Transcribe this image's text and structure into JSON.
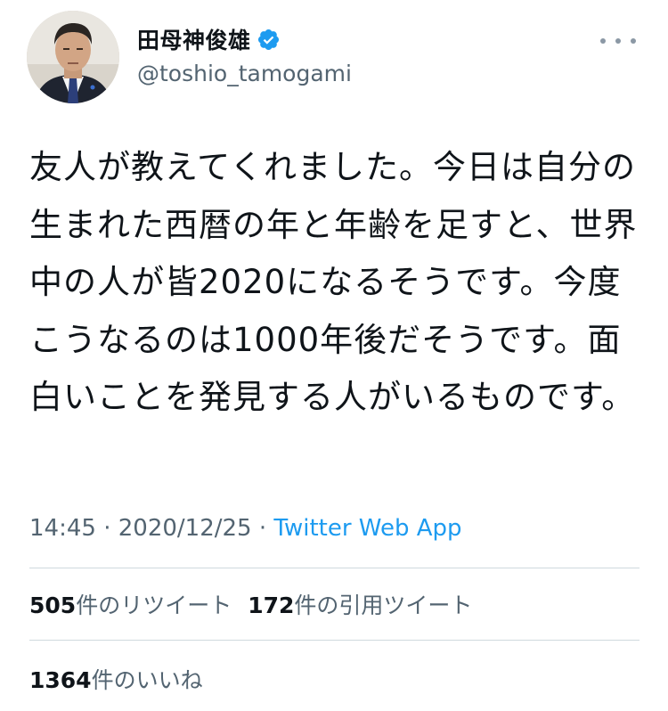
{
  "author": {
    "display_name": "田母神俊雄",
    "handle": "@toshio_tamogami",
    "verified": true,
    "avatar_icon": "profile-photo"
  },
  "tweet": {
    "text": "友人が教えてくれました。今日は自分の生まれた西暦の年と年齢を足すと、世界中の人が皆2020になるそうです。今度こうなるのは1000年後だそうです。面白いことを発見する人がいるものです。",
    "time": "14:45",
    "date": "2020/12/25",
    "separator": "·",
    "source": "Twitter Web App"
  },
  "stats": {
    "retweets": {
      "count": "505",
      "label": "件のリツイート"
    },
    "quotes": {
      "count": "172",
      "label": "件の引用ツイート"
    },
    "likes": {
      "count": "1364",
      "label": "件のいいね"
    }
  },
  "colors": {
    "text": "#0f1419",
    "secondary": "#536471",
    "link": "#1d9bf0",
    "verified_badge": "#1d9bf0",
    "divider": "#cfd9de"
  },
  "icons": {
    "verified": "verified-badge-icon",
    "more": "more-options-icon"
  }
}
